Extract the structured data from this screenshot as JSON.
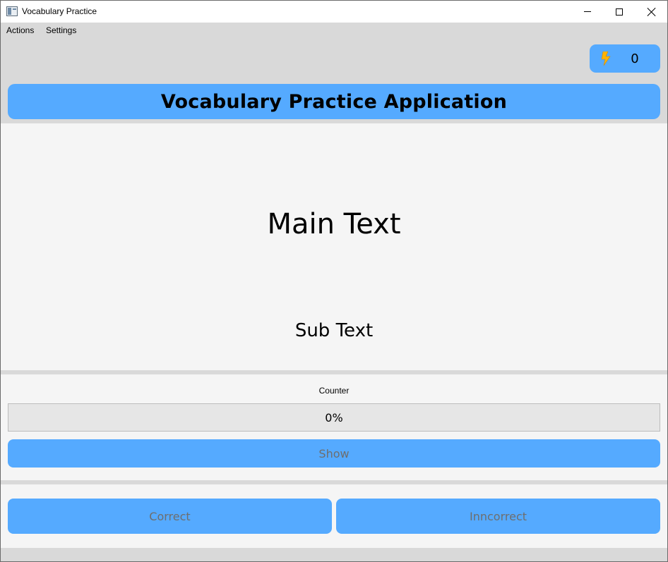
{
  "window": {
    "title": "Vocabulary Practice",
    "icon": "app-window-icon",
    "controls": [
      "minimize-icon",
      "maximize-icon",
      "close-icon"
    ]
  },
  "menu": {
    "items": [
      {
        "label": "Actions"
      },
      {
        "label": "Settings"
      }
    ]
  },
  "streak": {
    "icon": "lightning-icon",
    "count": "0",
    "icon_color": "#ffb300"
  },
  "header": {
    "title": "Vocabulary Practice Application"
  },
  "card": {
    "main_text": "Main Text",
    "sub_text": "Sub Text"
  },
  "counter": {
    "label": "Counter",
    "progress_percent": 0,
    "progress_text": "0%"
  },
  "buttons": {
    "show": "Show",
    "correct": "Correct",
    "incorrect": "Inncorrect"
  },
  "colors": {
    "accent": "#55aaff",
    "window_background": "#d9d9d9",
    "panel_background": "#f5f5f5",
    "disabled_text": "#6e6e6e"
  }
}
